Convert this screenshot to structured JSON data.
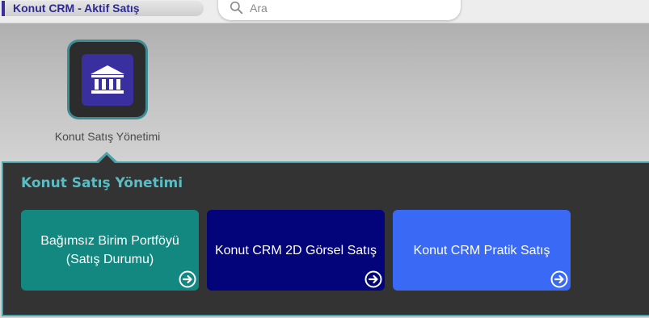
{
  "header": {
    "app_title": "Konut CRM - Aktif Satış",
    "search": {
      "placeholder": "Ara",
      "value": ""
    }
  },
  "module": {
    "label": "Konut Satış Yönetimi",
    "icon": "bank-building-icon"
  },
  "panel": {
    "title": "Konut Satış Yönetimi",
    "cards": [
      {
        "label": "Bağımsız Birim Portföyü (Satış Durumu)",
        "color": "#138880",
        "icon": "arrow-right-circle-icon"
      },
      {
        "label": "Konut CRM 2D Görsel Satış",
        "color": "#03047a",
        "icon": "arrow-right-circle-icon"
      },
      {
        "label": "Konut CRM Pratik Satış",
        "color": "#3a6af5",
        "icon": "arrow-right-circle-icon"
      }
    ]
  },
  "colors": {
    "accent": "#4aa3ab",
    "brand": "#3a2f9e",
    "panel_bg": "#333333"
  }
}
